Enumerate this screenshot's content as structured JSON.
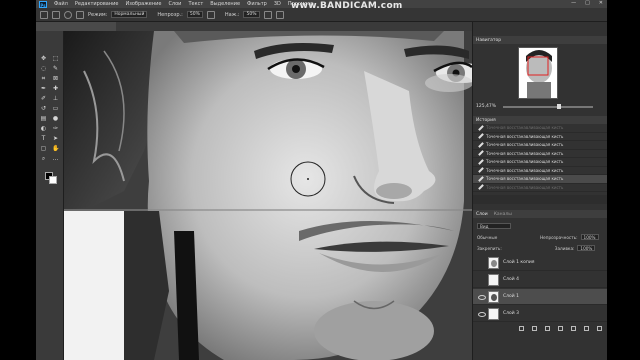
{
  "watermark": "www.BANDICAM.com",
  "app": {
    "logo": "Ps"
  },
  "menu": [
    "Файл",
    "Редактирование",
    "Изображение",
    "Слои",
    "Текст",
    "Выделение",
    "Фильтр",
    "3D",
    "Просмотр"
  ],
  "options": {
    "mode_label": "Режим:",
    "mode_value": "Нормальный",
    "opacity_label": "Непрозр.:",
    "opacity_value": "50%",
    "nazh_label": "Наж.:",
    "nazh_value": "50%"
  },
  "navigator": {
    "title": "Навигатор",
    "zoom": "125,47%"
  },
  "history": {
    "title": "История",
    "items": [
      "Точечная восстанавливающая кисть",
      "Точечная восстанавливающая кисть",
      "Точечная восстанавливающая кисть",
      "Точечная восстанавливающая кисть",
      "Точечная восстанавливающая кисть",
      "Точечная восстанавливающая кисть",
      "Точечная восстанавливающая кисть",
      "Точечная восстанавливающая кисть"
    ],
    "selected_index": 6
  },
  "layers": {
    "tabs": [
      "Слои",
      "Каналы"
    ],
    "kind_label": "Вид",
    "blend_mode": "Обычные",
    "opacity_label": "Непрозрачность:",
    "opacity_value": "100%",
    "lock_label": "Закрепить:",
    "fill_label": "Заливка:",
    "fill_value": "100%",
    "items": [
      {
        "name": "Слой 1 копия"
      },
      {
        "name": "Слой 4"
      },
      {
        "name": "Слой 1"
      },
      {
        "name": "Слой 3"
      }
    ],
    "selected_index": 2
  }
}
